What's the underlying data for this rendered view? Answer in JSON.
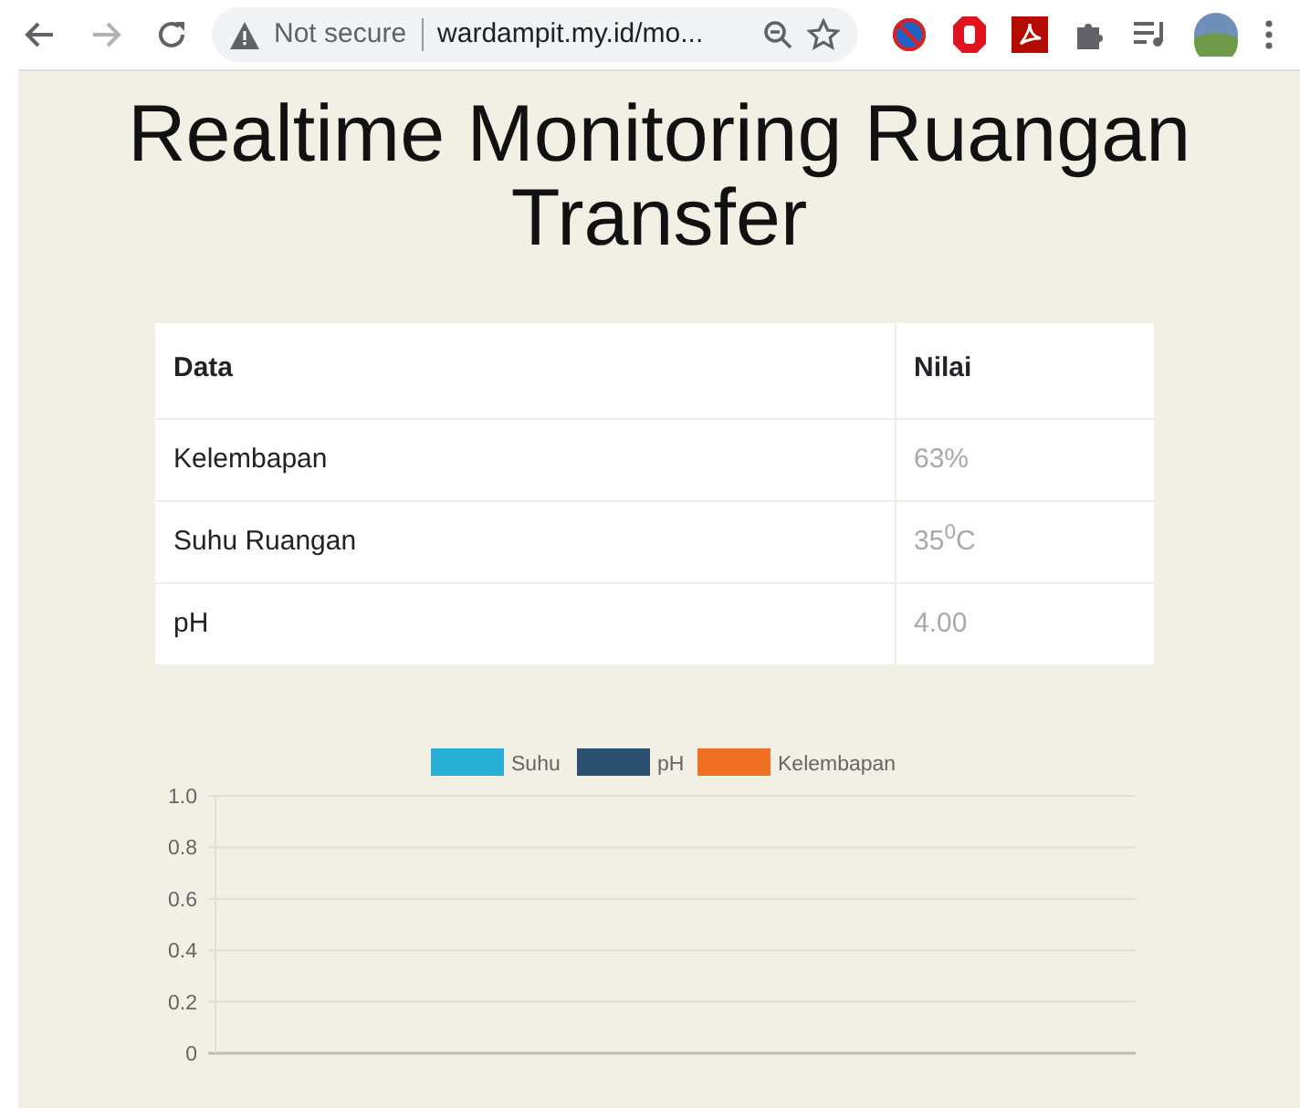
{
  "browser": {
    "security_label": "Not secure",
    "url": "wardampit.my.id/mo..."
  },
  "page": {
    "title": "Realtime Monitoring Ruangan Transfer"
  },
  "table": {
    "columns": [
      "Data",
      "Nilai"
    ],
    "rows": [
      {
        "label": "Kelembapan",
        "value": "63%"
      },
      {
        "label": "Suhu Ruangan",
        "value": "35$^{0}$C"
      },
      {
        "label": "pH",
        "value": "4.00"
      }
    ]
  },
  "chart_data": {
    "type": "line",
    "grid": true,
    "ylim": [
      0,
      1
    ],
    "yticks": [
      {
        "value": 0,
        "label": "0"
      },
      {
        "value": 0.2,
        "label": "0.2"
      },
      {
        "value": 0.4,
        "label": "0.4"
      },
      {
        "value": 0.6,
        "label": "0.6"
      },
      {
        "value": 0.8,
        "label": "0.8"
      },
      {
        "value": 1,
        "label": "1.0"
      }
    ],
    "series": [
      {
        "name": "Suhu",
        "color": "#29b0d6"
      },
      {
        "name": "pH",
        "color": "#2b4f6e"
      },
      {
        "name": "Kelembapan",
        "color": "#f07124"
      }
    ]
  }
}
